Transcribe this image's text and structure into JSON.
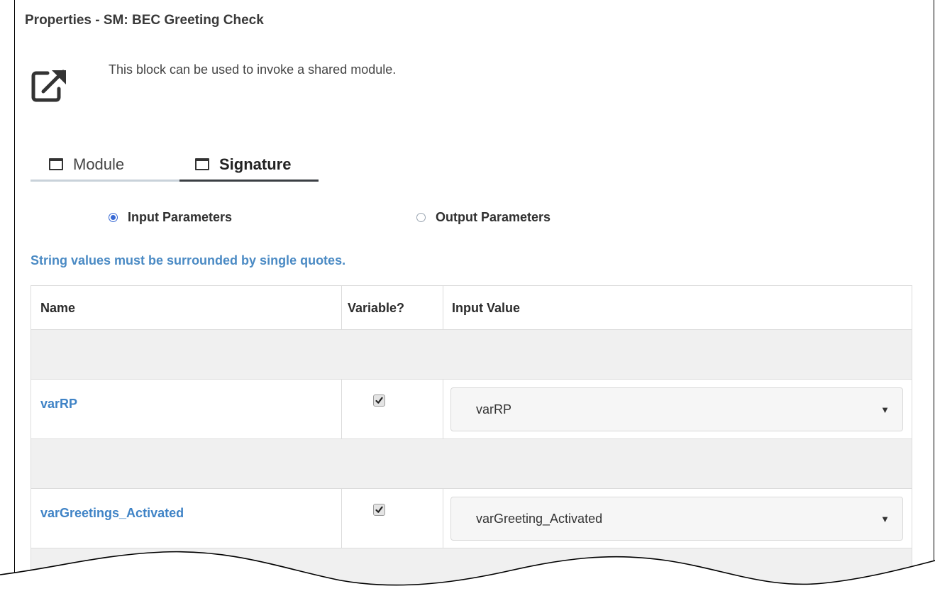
{
  "panel": {
    "title": "Properties - SM: BEC Greeting Check",
    "description": "This block can be used to invoke a shared module."
  },
  "tabs": [
    {
      "label": "Module",
      "active": false
    },
    {
      "label": "Signature",
      "active": true
    }
  ],
  "params_mode": {
    "input_label": "Input Parameters",
    "output_label": "Output Parameters",
    "selected": "input"
  },
  "note": "String values must be surrounded by single quotes.",
  "table": {
    "headers": {
      "name": "Name",
      "variable": "Variable?",
      "value": "Input Value"
    },
    "rows": [
      {
        "name": "varRP",
        "variable": true,
        "value": "varRP"
      },
      {
        "name": "varGreetings_Activated",
        "variable": true,
        "value": "varGreeting_Activated"
      }
    ]
  },
  "colors": {
    "accent": "#3869d4",
    "link": "#3f83c6",
    "note": "#4a8ac4"
  }
}
